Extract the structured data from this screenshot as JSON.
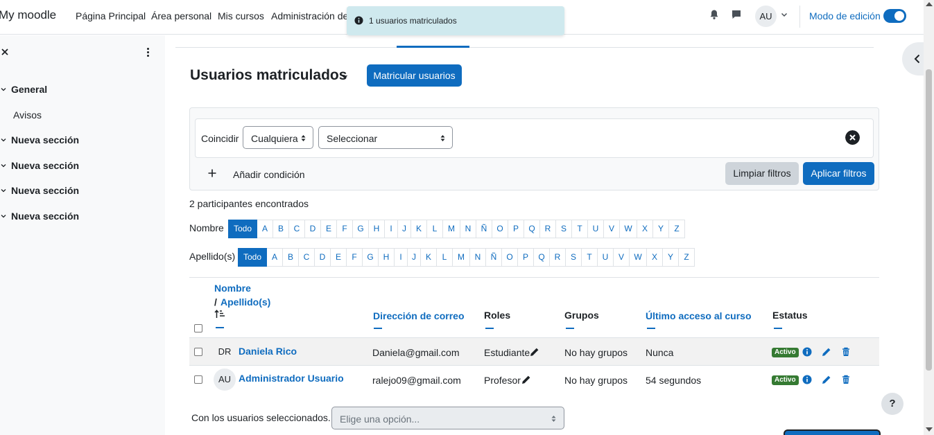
{
  "navbar": {
    "brand": "My moodle",
    "links": [
      "Página Principal",
      "Área personal",
      "Mis cursos",
      "Administración de"
    ],
    "avatar_initials": "AU",
    "edit_mode_label": "Modo de edición"
  },
  "toast": {
    "message": "1 usuarios matriculados"
  },
  "drawer": {
    "sections": [
      {
        "label": "General",
        "expanded": true
      },
      {
        "label": "Avisos",
        "child": true
      },
      {
        "label": "Nueva sección",
        "expanded": true
      },
      {
        "label": "Nueva sección",
        "expanded": true
      },
      {
        "label": "Nueva sección",
        "expanded": true
      },
      {
        "label": "Nueva sección",
        "expanded": true
      }
    ]
  },
  "main": {
    "title": "Usuarios matriculados",
    "enrol_button": "Matricular usuarios",
    "filter": {
      "match_label": "Coincidir",
      "match_value": "Cualquiera",
      "type_value": "Seleccionar",
      "add_condition": "Añadir condición",
      "clear_button": "Limpiar filtros",
      "apply_button": "Aplicar filtros"
    },
    "found_text": "2 participantes encontrados",
    "firstname_label": "Nombre",
    "lastname_label": "Apellido(s)",
    "letters": [
      "Todo",
      "A",
      "B",
      "C",
      "D",
      "E",
      "F",
      "G",
      "H",
      "I",
      "J",
      "K",
      "L",
      "M",
      "N",
      "Ñ",
      "O",
      "P",
      "Q",
      "R",
      "S",
      "T",
      "U",
      "V",
      "W",
      "X",
      "Y",
      "Z"
    ],
    "table": {
      "headers": {
        "first_name": "Nombre",
        "last_name": "Apellido(s)",
        "name_separator": "/",
        "email": "Dirección de correo",
        "roles": "Roles",
        "groups": "Grupos",
        "last_access": "Último acceso al curso",
        "status": "Estatus"
      },
      "rows": [
        {
          "initials": "DR",
          "name": "Daniela Rico",
          "email": "Daniela@gmail.com",
          "role": "Estudiante",
          "groups": "No hay grupos",
          "last_access": "Nunca",
          "status": "Activo"
        },
        {
          "initials": "AU",
          "name": "Administrador Usuario",
          "email": "ralejo09@gmail.com",
          "role": "Profesor",
          "groups": "No hay grupos",
          "last_access": "54 segundos",
          "status": "Activo"
        }
      ]
    },
    "bulk": {
      "label": "Con los usuarios seleccionados...",
      "placeholder": "Elige una opción..."
    }
  },
  "help": "?",
  "colors": {
    "primary": "#0f6cbf",
    "success": "#357a32",
    "danger": "#ca3120"
  }
}
